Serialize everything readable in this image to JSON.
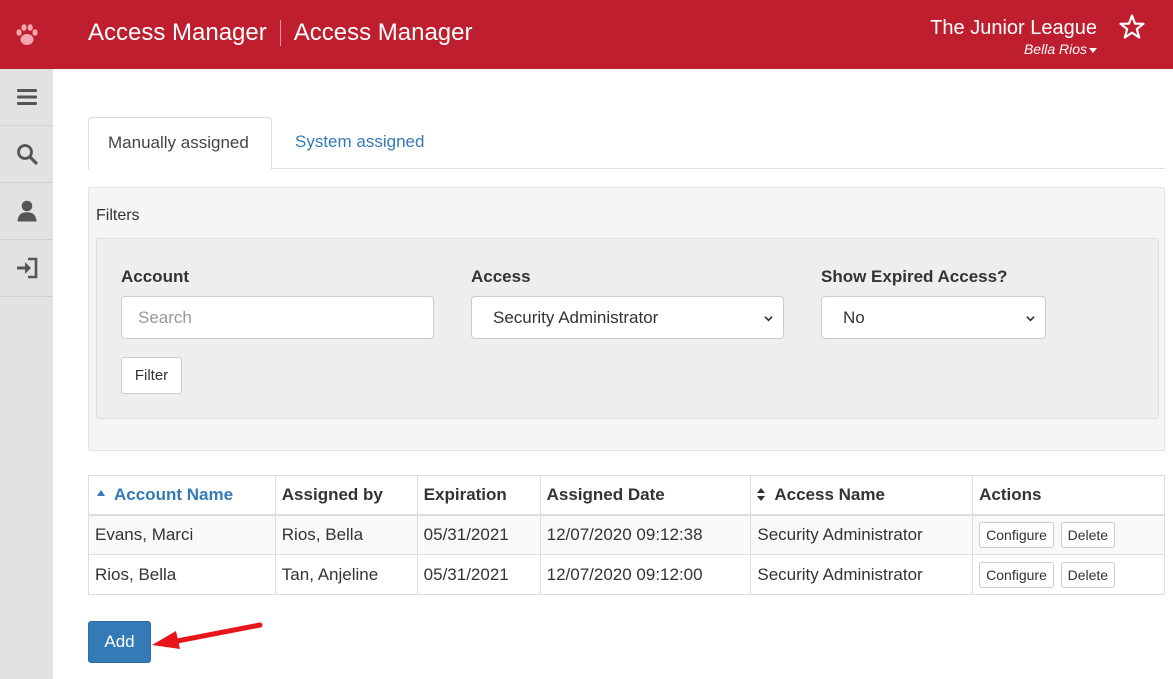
{
  "header": {
    "title_primary": "Access Manager",
    "title_secondary": "Access Manager",
    "organization": "The Junior League",
    "user": "Bella Rios",
    "brand_color": "#be1e2d",
    "logo_icon": "paw-icon",
    "favorite_icon": "star-outline-icon"
  },
  "sidebar": {
    "items": [
      {
        "icon": "menu-icon"
      },
      {
        "icon": "search-icon"
      },
      {
        "icon": "user-icon"
      },
      {
        "icon": "sign-out-icon"
      }
    ]
  },
  "tabs": [
    {
      "label": "Manually assigned",
      "active": true
    },
    {
      "label": "System assigned",
      "active": false
    }
  ],
  "filters": {
    "title": "Filters",
    "account": {
      "label": "Account",
      "placeholder": "Search",
      "value": ""
    },
    "access": {
      "label": "Access",
      "value": "Security Administrator"
    },
    "expired": {
      "label": "Show Expired Access?",
      "value": "No"
    },
    "filter_button": "Filter"
  },
  "table": {
    "columns": [
      "Account Name",
      "Assigned by",
      "Expiration",
      "Assigned Date",
      "Access Name",
      "Actions"
    ],
    "rows": [
      {
        "account": "Evans, Marci",
        "assigned_by": "Rios, Bella",
        "expiration": "05/31/2021",
        "assigned_date": "12/07/2020 09:12:38",
        "access_name": "Security Administrator"
      },
      {
        "account": "Rios, Bella",
        "assigned_by": "Tan, Anjeline",
        "expiration": "05/31/2021",
        "assigned_date": "12/07/2020 09:12:00",
        "access_name": "Security Administrator"
      }
    ],
    "configure_label": "Configure",
    "delete_label": "Delete"
  },
  "add_button": "Add",
  "colors": {
    "link": "#337ab7",
    "annotation_arrow": "#e8161a"
  }
}
